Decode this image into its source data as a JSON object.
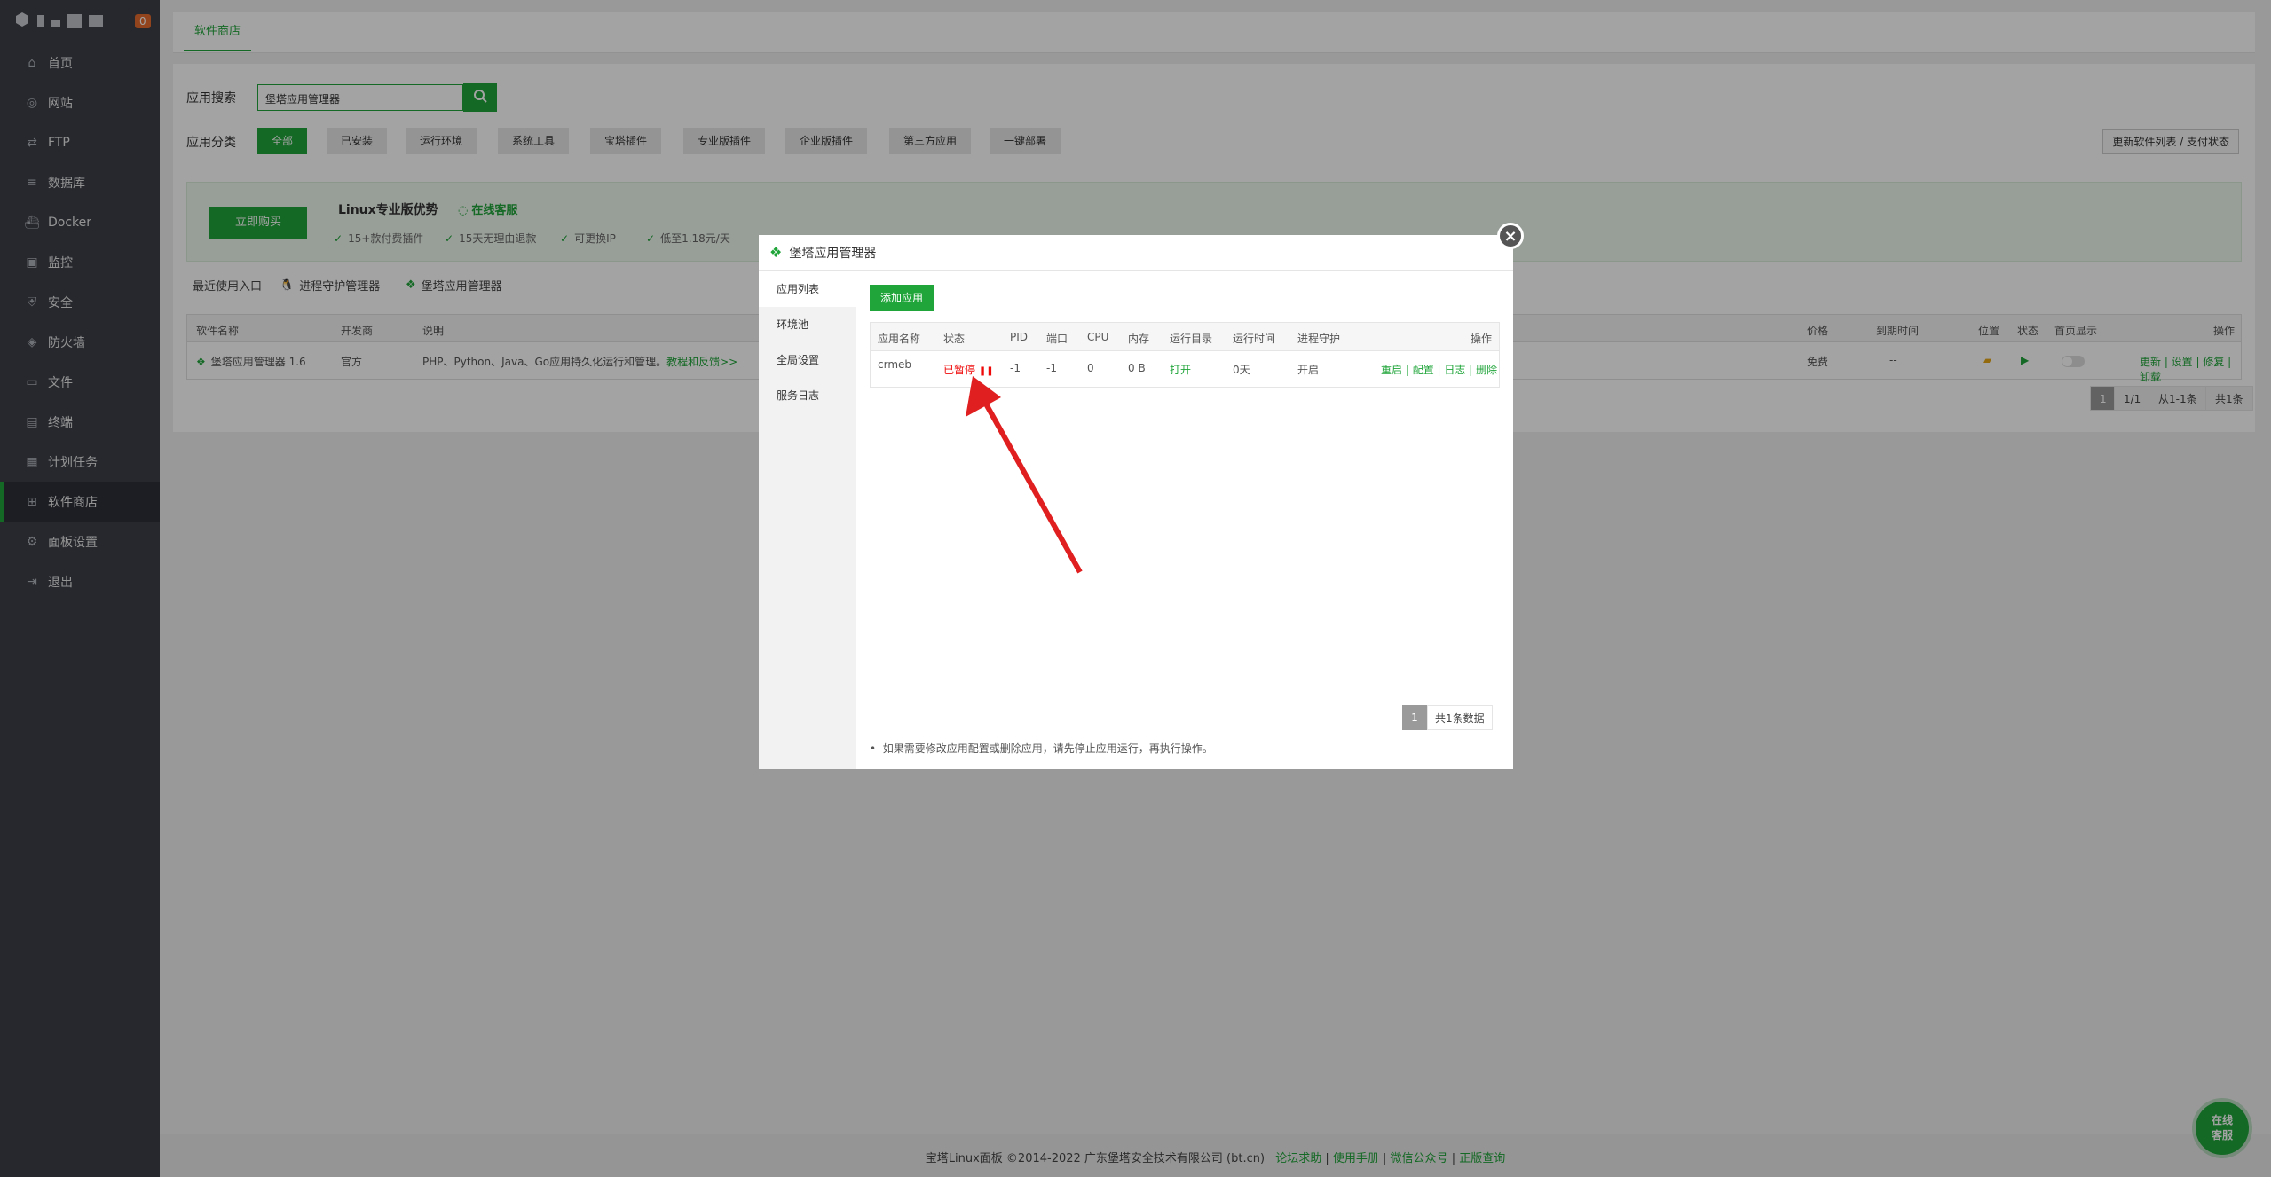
{
  "sidebar": {
    "badge": "0",
    "items": [
      {
        "label": "首页",
        "icon": "home-icon"
      },
      {
        "label": "网站",
        "icon": "globe-icon"
      },
      {
        "label": "FTP",
        "icon": "ftp-icon"
      },
      {
        "label": "数据库",
        "icon": "database-icon"
      },
      {
        "label": "Docker",
        "icon": "docker-icon"
      },
      {
        "label": "监控",
        "icon": "monitor-icon"
      },
      {
        "label": "安全",
        "icon": "shield-icon"
      },
      {
        "label": "防火墙",
        "icon": "firewall-icon"
      },
      {
        "label": "文件",
        "icon": "folder-icon"
      },
      {
        "label": "终端",
        "icon": "terminal-icon"
      },
      {
        "label": "计划任务",
        "icon": "calendar-icon"
      },
      {
        "label": "软件商店",
        "icon": "apps-icon"
      },
      {
        "label": "面板设置",
        "icon": "gear-icon"
      },
      {
        "label": "退出",
        "icon": "logout-icon"
      }
    ],
    "active_index": 11
  },
  "tabbar": {
    "tab": "软件商店"
  },
  "store": {
    "search_label": "应用搜索",
    "search_value": "堡塔应用管理器",
    "category_label": "应用分类",
    "categories": [
      "全部",
      "已安装",
      "运行环境",
      "系统工具",
      "宝塔插件",
      "专业版插件",
      "企业版插件",
      "第三方应用",
      "一键部署"
    ],
    "update_button": "更新软件列表 / 支付状态",
    "promo": {
      "buy_button": "立即购买",
      "title": "Linux专业版优势",
      "service": "在线客服",
      "features": [
        "15+款付费插件",
        "15天无理由退款",
        "可更换IP",
        "低至1.18元/天"
      ]
    },
    "recent_label": "最近使用入口",
    "recent_items": [
      "进程守护管理器",
      "堡塔应用管理器"
    ],
    "table": {
      "headers": [
        "软件名称",
        "开发商",
        "说明",
        "价格",
        "到期时间",
        "位置",
        "状态",
        "首页显示",
        "操作"
      ],
      "row": {
        "name": "堡塔应用管理器 1.6",
        "developer": "官方",
        "desc": "PHP、Python、Java、Go应用持久化运行和管理。",
        "desc_link": "教程和反馈>>",
        "price": "免费",
        "expiry": "--",
        "actions": "更新 | 设置 | 修复 | 卸载"
      }
    },
    "pagination": {
      "current": "1",
      "pages": "1/1",
      "range": "从1-1条",
      "total": "共1条"
    }
  },
  "footer": {
    "text": "宝塔Linux面板 ©2014-2022 广东堡塔安全技术有限公司 (bt.cn)",
    "links": [
      "论坛求助",
      "使用手册",
      "微信公众号",
      "正版查询"
    ]
  },
  "chat_bubble": {
    "line1": "在线",
    "line2": "客服"
  },
  "modal": {
    "title": "堡塔应用管理器",
    "tabs": [
      "应用列表",
      "环境池",
      "全局设置",
      "服务日志"
    ],
    "add_button": "添加应用",
    "table": {
      "headers": [
        "应用名称",
        "状态",
        "PID",
        "端口",
        "CPU",
        "内存",
        "运行目录",
        "运行时间",
        "进程守护",
        "操作"
      ],
      "row": {
        "name": "crmeb",
        "status": "已暂停",
        "pid": "-1",
        "port": "-1",
        "cpu": "0",
        "mem": "0 B",
        "dir": "打开",
        "uptime": "0天",
        "guard": "开启",
        "actions": [
          "重启",
          "配置",
          "日志",
          "删除"
        ]
      }
    },
    "pagination": {
      "current": "1",
      "total": "共1条数据"
    },
    "note": "如果需要修改应用配置或删除应用，请先停止应用运行，再执行操作。"
  },
  "colors": {
    "accent": "#20a53a",
    "danger": "#ef0808",
    "sidebar": "#3c3f48",
    "annotation_arrow": "#e02020"
  }
}
